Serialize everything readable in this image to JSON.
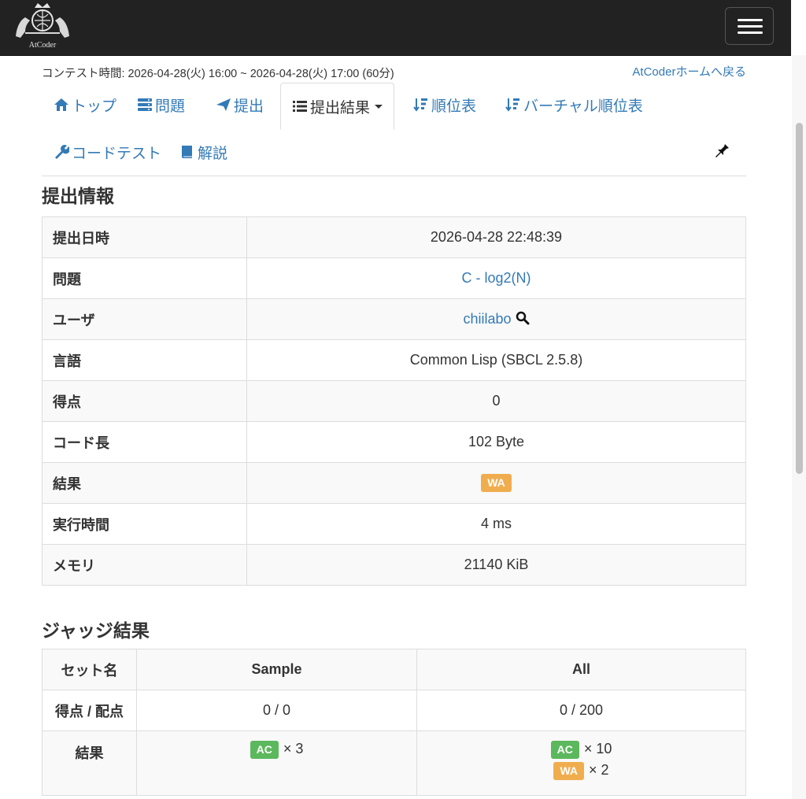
{
  "colors": {
    "navbar": "#222222",
    "link": "#337ab7",
    "wa": "#f0ad4e",
    "ac": "#5cb85c"
  },
  "header": {
    "logo_text": "AtCoder",
    "menu_icon": "hamburger-icon"
  },
  "contest_time": "コンテスト時間: 2026-04-28(火) 16:00 ~ 2026-04-28(火) 17:00 (60分)",
  "back_home": "AtCoderホームへ戻る",
  "tabs": [
    {
      "label": "トップ",
      "icon": "home-icon"
    },
    {
      "label": "問題",
      "icon": "tasks-icon"
    },
    {
      "label": "提出",
      "icon": "send-icon"
    },
    {
      "label": "提出結果",
      "icon": "list-icon",
      "active": true
    },
    {
      "label": "順位表",
      "icon": "sort-icon"
    },
    {
      "label": "バーチャル順位表",
      "icon": "sort-icon"
    },
    {
      "label": "コードテスト",
      "icon": "wrench-icon"
    },
    {
      "label": "解説",
      "icon": "book-icon"
    }
  ],
  "submission": {
    "title": "提出情報",
    "rows": [
      {
        "label": "提出日時",
        "value": "2026-04-28 22:48:39"
      },
      {
        "label": "問題",
        "value": "C - log2(N)"
      },
      {
        "label": "ユーザ",
        "value": "chiilabo"
      },
      {
        "label": "言語",
        "value": "Common Lisp (SBCL 2.5.8)"
      },
      {
        "label": "得点",
        "value": "0"
      },
      {
        "label": "コード長",
        "value": "102 Byte"
      },
      {
        "label": "結果",
        "value": "WA"
      },
      {
        "label": "実行時間",
        "value": "4 ms"
      },
      {
        "label": "メモリ",
        "value": "21140 KiB"
      }
    ]
  },
  "judge": {
    "title": "ジャッジ結果",
    "set_name_header": "セット名",
    "score_header": "得点 / 配点",
    "result_header": "結果",
    "sets": [
      {
        "name": "Sample",
        "score": "0 / 0",
        "results": [
          {
            "status": "AC",
            "count": "× 3"
          }
        ]
      },
      {
        "name": "All",
        "score": "0 / 200",
        "results": [
          {
            "status": "AC",
            "count": "× 10"
          },
          {
            "status": "WA",
            "count": "× 2"
          }
        ]
      }
    ]
  }
}
